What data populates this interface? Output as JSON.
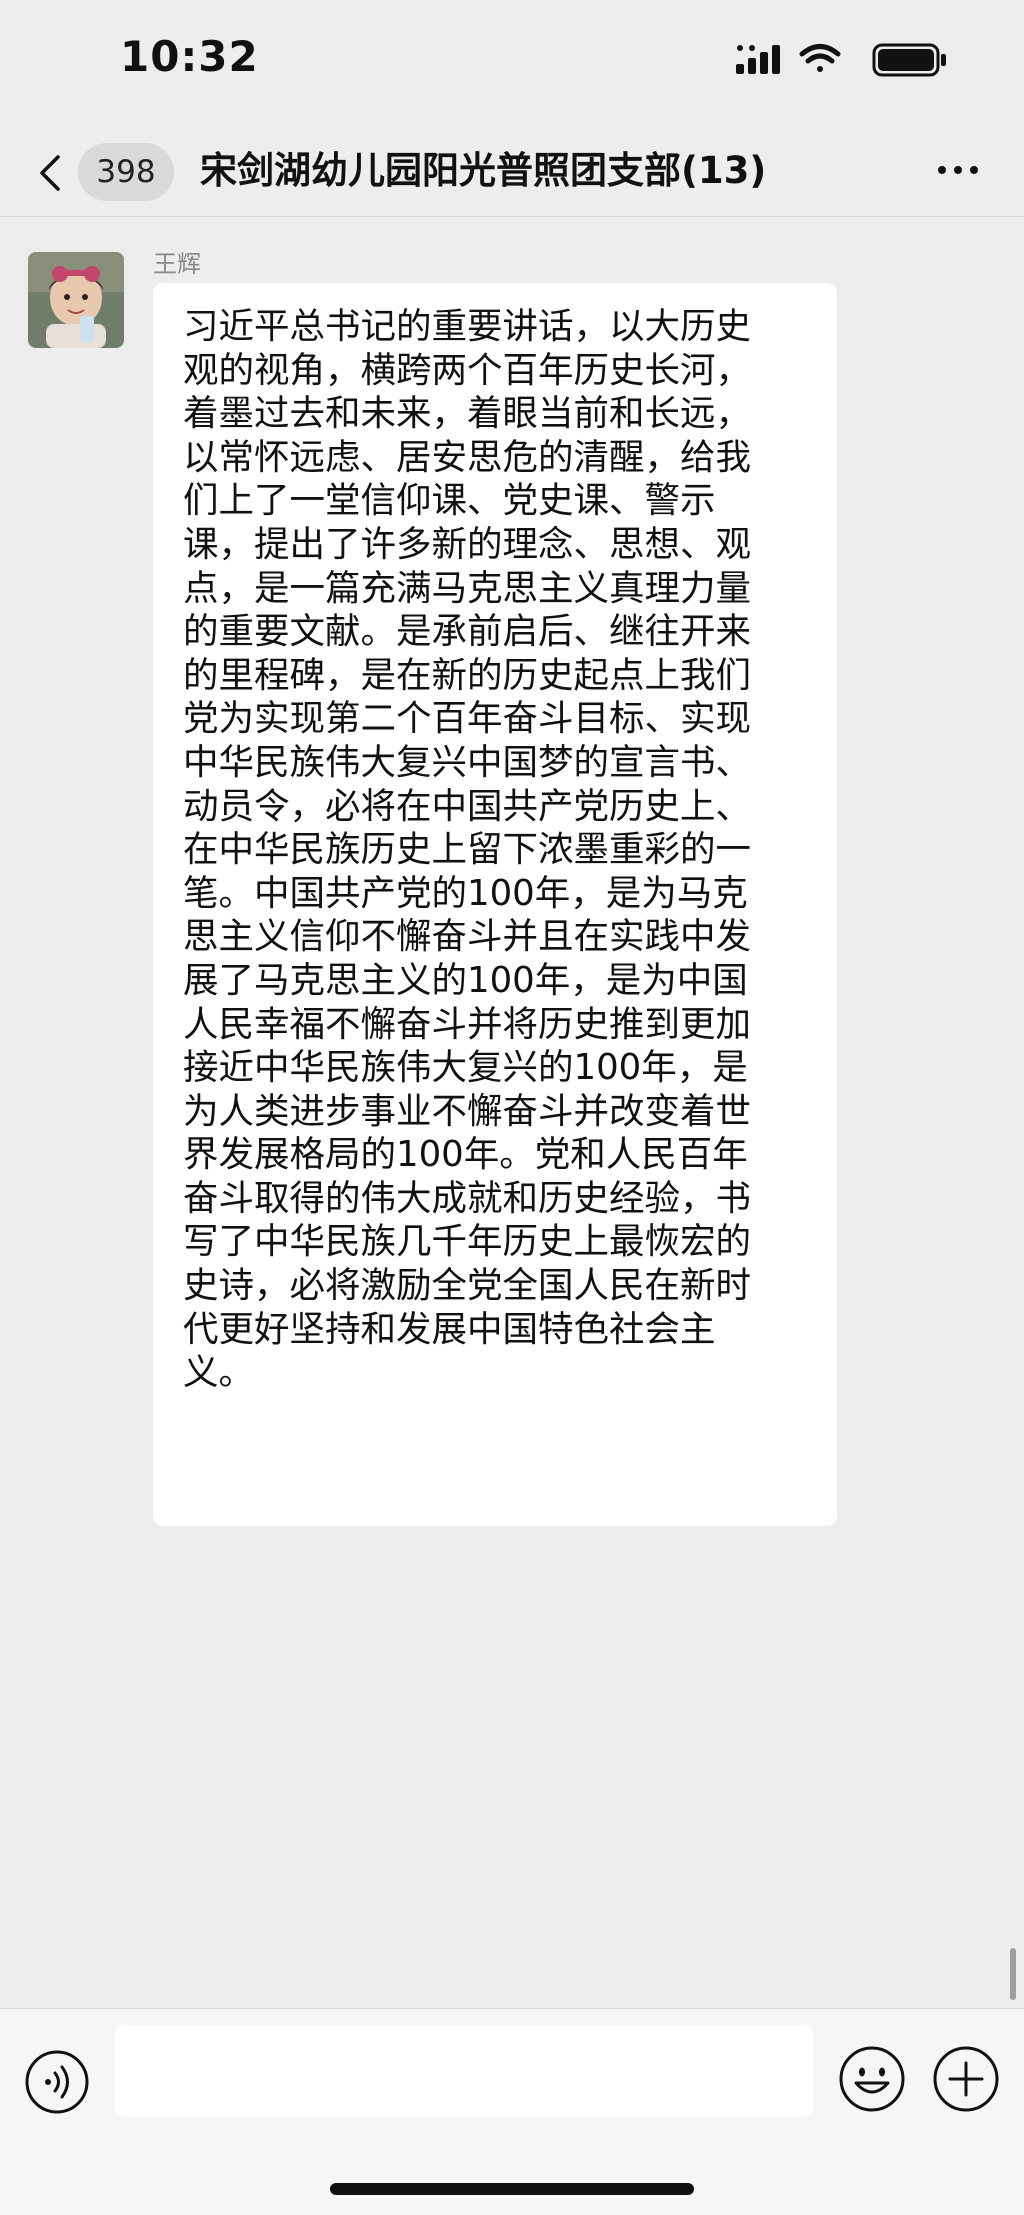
{
  "status_bar": {
    "time": "10:32",
    "icons": [
      "cellular-signal-icon",
      "wifi-icon",
      "battery-icon"
    ]
  },
  "nav": {
    "back_icon": "chevron-left-icon",
    "unread_count": "398",
    "title": "宋剑湖幼儿园阳光普照团支部(13)",
    "more_icon": "more-dots-icon"
  },
  "messages": [
    {
      "sender": "王辉",
      "avatar_icon": "avatar-photo",
      "text": "习近平总书记的重要讲话，以大历史\n观的视角，横跨两个百年历史长河，\n着墨过去和未来，着眼当前和长远，\n以常怀远虑、居安思危的清醒，给我\n们上了一堂信仰课、党史课、警示\n课，提出了许多新的理念、思想、观\n点，是一篇充满马克思主义真理力量\n的重要文献。是承前启后、继往开来\n的里程碑，是在新的历史起点上我们\n党为实现第二个百年奋斗目标、实现\n中华民族伟大复兴中国梦的宣言书、\n动员令，必将在中国共产党历史上、\n在中华民族历史上留下浓墨重彩的一\n笔。中国共产党的100年，是为马克\n思主义信仰不懈奋斗并且在实践中发\n展了马克思主义的100年，是为中国\n人民幸福不懈奋斗并将历史推到更加\n接近中华民族伟大复兴的100年，是\n为人类进步事业不懈奋斗并改变着世\n界发展格局的100年。党和人民百年\n奋斗取得的伟大成就和历史经验，书\n写了中华民族几千年历史上最恢宏的\n史诗，必将激励全党全国人民在新时\n代更好坚持和发展中国特色社会主\n义。"
    }
  ],
  "input_bar": {
    "input_value": "",
    "icons": [
      "voice-icon",
      "emoji-icon",
      "plus-icon"
    ]
  },
  "colors": {
    "background": "#ededed",
    "bubble": "#ffffff",
    "text": "#111111",
    "badge": "#d9d9d9"
  }
}
